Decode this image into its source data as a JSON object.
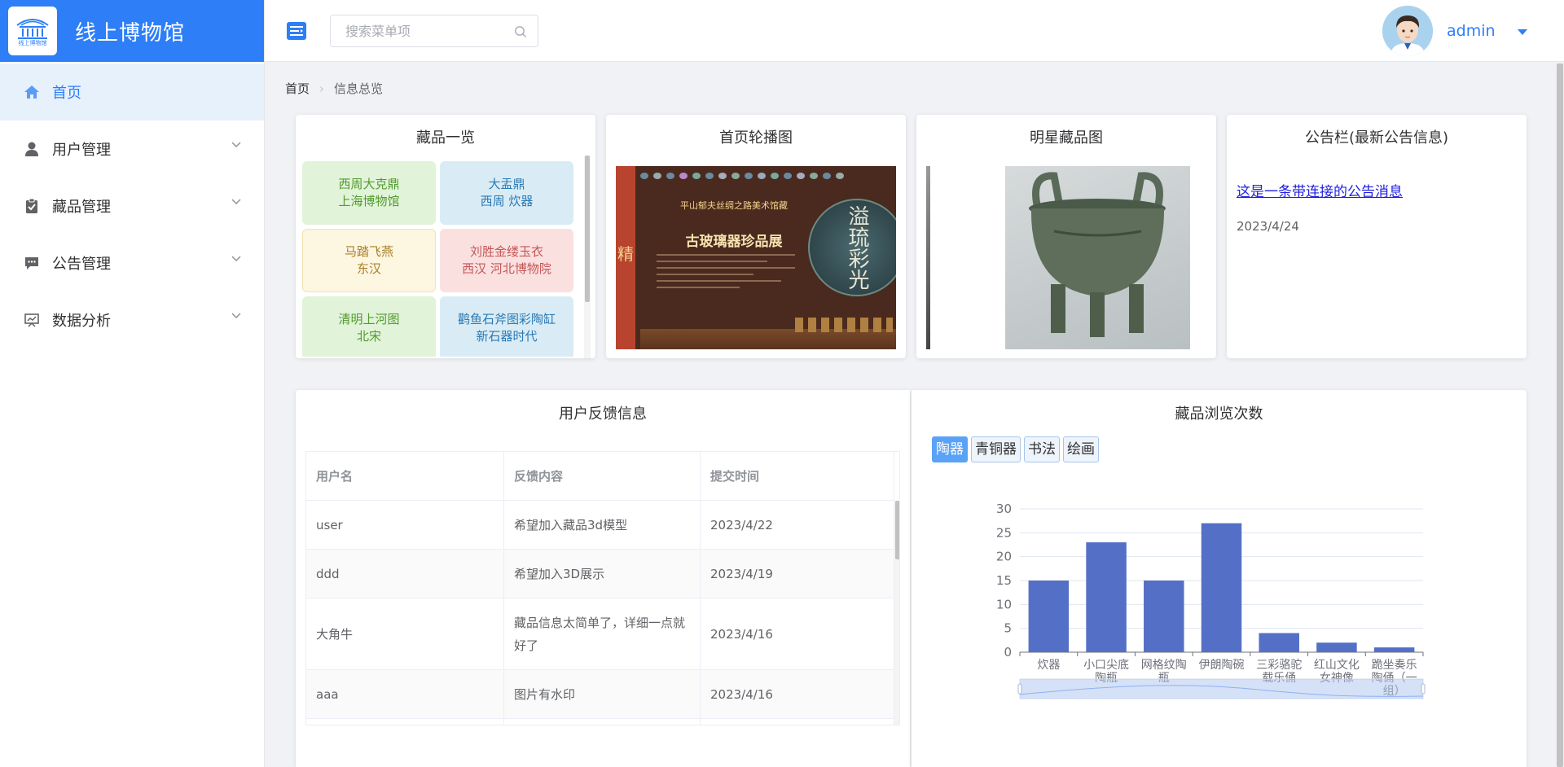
{
  "app": {
    "title": "线上博物馆",
    "logo_text": "线上博物馆"
  },
  "header": {
    "search_placeholder": "搜索菜单项",
    "user_name": "admin"
  },
  "sidebar": {
    "items": [
      {
        "label": "首页",
        "icon": "home-icon",
        "active": true
      },
      {
        "label": "用户管理",
        "icon": "user-icon"
      },
      {
        "label": "藏品管理",
        "icon": "clipboard-icon"
      },
      {
        "label": "公告管理",
        "icon": "message-icon"
      },
      {
        "label": "数据分析",
        "icon": "chart-icon"
      }
    ]
  },
  "breadcrumb": {
    "home": "首页",
    "current": "信息总览"
  },
  "collections": {
    "title": "藏品一览",
    "items": [
      {
        "line1": "西周大克鼎",
        "line2": "上海博物馆",
        "color": "#e1f3d8"
      },
      {
        "line1": "大盂鼎",
        "line2": "西周 炊器",
        "color": "#d9ecf5"
      },
      {
        "line1": "马踏飞燕",
        "line2": "东汉",
        "color": "#fdf6e0"
      },
      {
        "line1": "刘胜金缕玉衣",
        "line2": "西汉 河北博物院",
        "color": "#fbe0e0"
      },
      {
        "line1": "清明上河图",
        "line2": "北宋",
        "color": "#e1f3d8"
      },
      {
        "line1": "鹳鱼石斧图彩陶缸",
        "line2": "新石器时代",
        "color": "#d9ecf5"
      }
    ]
  },
  "carousel": {
    "title": "首页轮播图",
    "banner_small": "平山郁夫丝绸之路美术馆藏",
    "banner_title": "古玻璃器珍品展",
    "banner_side": "精",
    "banner_art": "溢琉彩光"
  },
  "star": {
    "title": "明星藏品图"
  },
  "notice": {
    "title": "公告栏(最新公告信息)",
    "link_text": "这是一条带连接的公告消息",
    "date": "2023/4/24"
  },
  "feedback": {
    "title": "用户反馈信息",
    "columns": [
      "用户名",
      "反馈内容",
      "提交时间"
    ],
    "rows": [
      {
        "user": "user",
        "content": "希望加入藏品3d模型",
        "time": "2023/4/22"
      },
      {
        "user": "ddd",
        "content": "希望加入3D展示",
        "time": "2023/4/19"
      },
      {
        "user": "大角牛",
        "content": "藏品信息太简单了，详细一点就好了",
        "time": "2023/4/16"
      },
      {
        "user": "aaa",
        "content": "图片有水印",
        "time": "2023/4/16"
      }
    ]
  },
  "views": {
    "title": "藏品浏览次数",
    "tabs": [
      "陶器",
      "青铜器",
      "书法",
      "绘画"
    ],
    "active_tab": "陶器"
  },
  "chart_data": {
    "type": "bar",
    "categories": [
      "炊器",
      "小口尖底陶瓶",
      "网格纹陶瓶",
      "伊朗陶碗",
      "三彩骆驼载乐俑",
      "红山文化女神像",
      "跪坐奏乐陶俑（一组）"
    ],
    "tick_lines": [
      [
        "炊器"
      ],
      [
        "小口尖底",
        "陶瓶"
      ],
      [
        "网格纹陶",
        "瓶"
      ],
      [
        "伊朗陶碗"
      ],
      [
        "三彩骆驼",
        "载乐俑"
      ],
      [
        "红山文化",
        "女神像"
      ],
      [
        "跪坐奏乐",
        "陶俑（一",
        "组）"
      ]
    ],
    "values": [
      15,
      23,
      15,
      27,
      4,
      2,
      1
    ],
    "ylim": [
      0,
      30
    ],
    "yticks": [
      0,
      5,
      10,
      15,
      20,
      25,
      30
    ],
    "bar_color": "#5470c6",
    "grid": true,
    "data_zoom": true
  }
}
